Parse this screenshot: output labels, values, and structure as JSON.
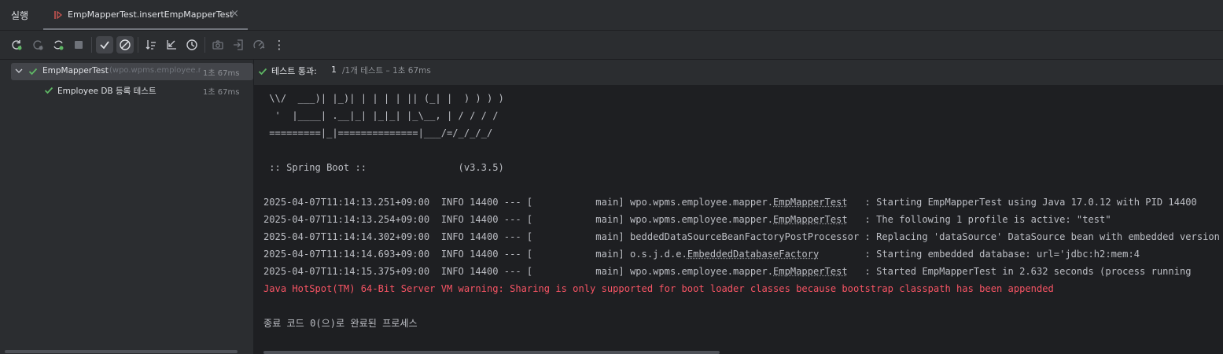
{
  "tabbar": {
    "run_label": "실행",
    "tab_title": "EmpMapperTest.insertEmpMapperTest",
    "close_glyph": "×"
  },
  "toolbar": {
    "buttons": [
      "rerun-icon",
      "rerun-failed-icon",
      "toggle-auto-test-icon",
      "stop-icon",
      "show-passed-icon",
      "show-ignored-icon",
      "sort-alpha-icon",
      "sort-duration-icon",
      "history-icon",
      "screenshot-icon",
      "import-icon",
      "export-icon",
      "more-icon"
    ],
    "more_glyph": "⋮"
  },
  "tree": {
    "root": {
      "name": "EmpMapperTest",
      "package": "(wpo.wpms.employee.mapper)",
      "duration": "1초 67ms"
    },
    "child": {
      "name": "Employee DB 등록 테스트",
      "duration": "1초 67ms"
    }
  },
  "console_header": {
    "pass_label": "테스트 통과:",
    "pass_count": "1",
    "pass_detail": "/1개 테스트 – 1초 67ms"
  },
  "console": {
    "banner": [
      " \\\\/  ___)| |_)| | | | | || (_| |  ) ) ) )",
      "  '  |____| .__|_| |_|_| |_\\__, | / / / /",
      " =========|_|==============|___/=/_/_/_/"
    ],
    "spring_boot_line": " :: Spring Boot ::                (v3.3.5)",
    "logs": [
      {
        "prefix": "2025-04-07T11:14:13.251+09:00  INFO 14400 --- [           main] wpo.wpms.employee.mapper.",
        "logger": "EmpMapperTest",
        "suffix": "   : Starting EmpMapperTest using Java 17.0.12 with PID 14400"
      },
      {
        "prefix": "2025-04-07T11:14:13.254+09:00  INFO 14400 --- [           main] wpo.wpms.employee.mapper.",
        "logger": "EmpMapperTest",
        "suffix": "   : The following 1 profile is active: \"test\""
      },
      {
        "prefix": "2025-04-07T11:14:14.302+09:00  INFO 14400 --- [           main] beddedDataSourceBeanFactoryPostProcessor",
        "logger": "",
        "suffix": " : Replacing 'dataSource' DataSource bean with embedded version"
      },
      {
        "prefix": "2025-04-07T11:14:14.693+09:00  INFO 14400 --- [           main] o.s.j.d.e.",
        "logger": "EmbeddedDatabaseFactory",
        "suffix": "        : Starting embedded database: url='jdbc:h2:mem:4"
      },
      {
        "prefix": "2025-04-07T11:14:15.375+09:00  INFO 14400 --- [           main] wpo.wpms.employee.mapper.",
        "logger": "EmpMapperTest",
        "suffix": "   : Started EmpMapperTest in 2.632 seconds (process running"
      }
    ],
    "warning": "Java HotSpot(TM) 64-Bit Server VM warning: Sharing is only supported for boot loader classes because bootstrap classpath has been appended",
    "exit_line": "종료 코드 0(으)로 완료된 프로세스"
  },
  "colors": {
    "background": "#2b2d30",
    "console_bg": "#1e1f22",
    "pass_green": "#5fb865",
    "error_red": "#f75464"
  }
}
